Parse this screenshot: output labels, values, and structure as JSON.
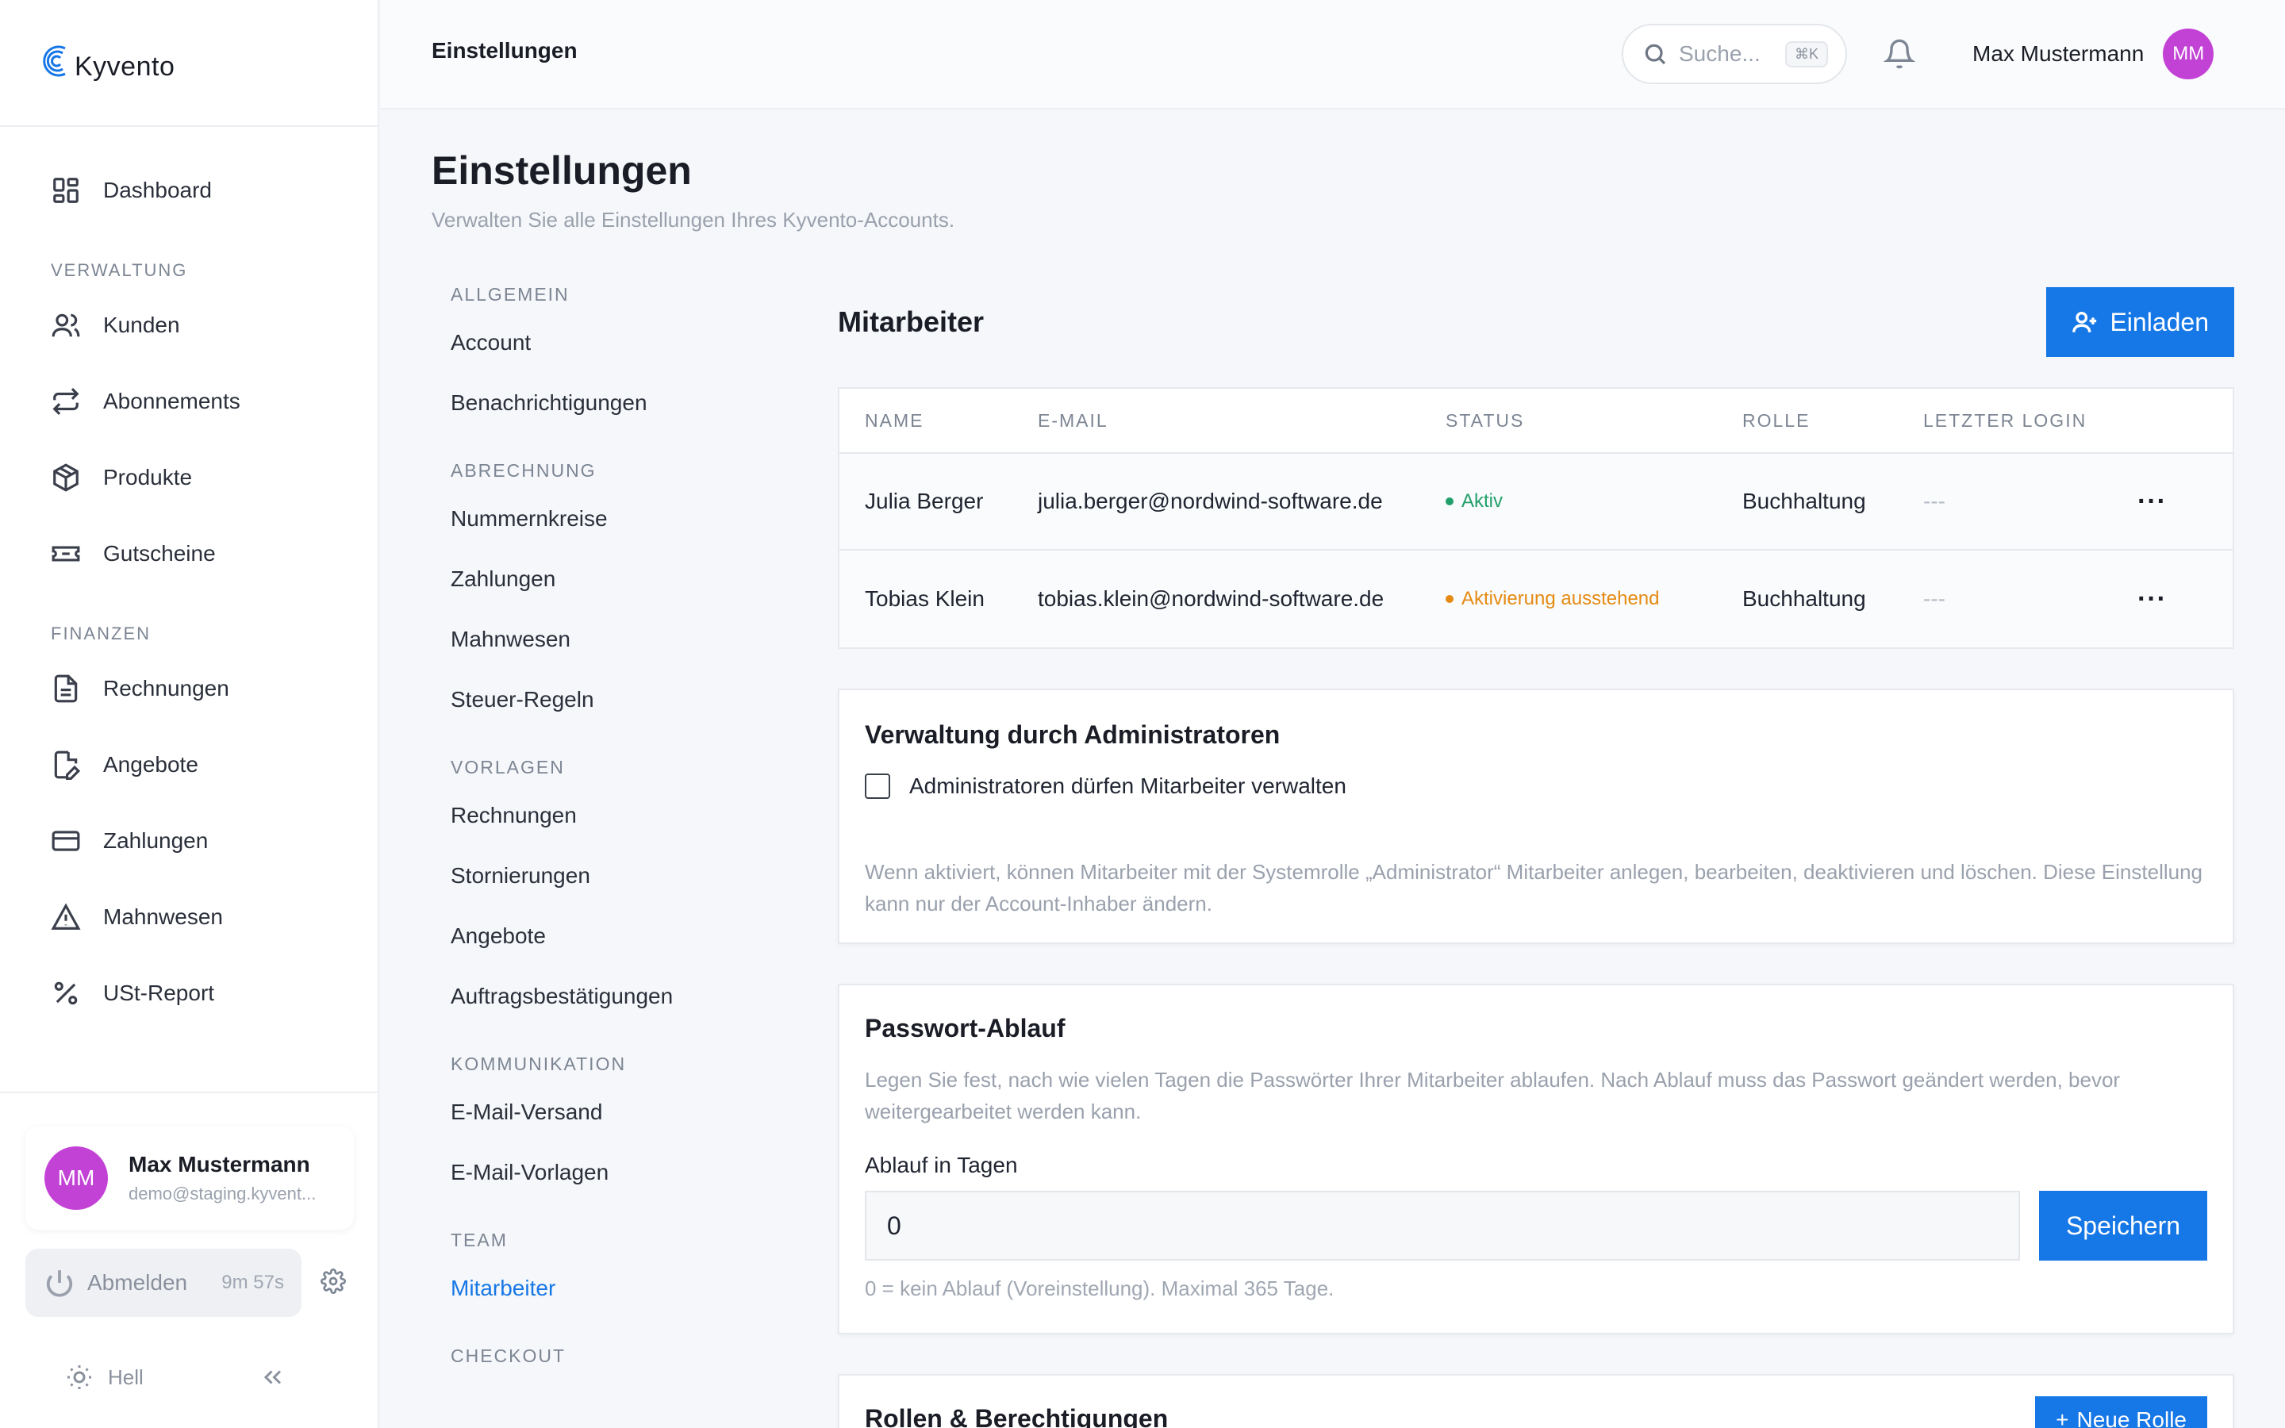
{
  "app": {
    "name": "Kyvento"
  },
  "sidebar": {
    "dashboard": "Dashboard",
    "groups": [
      {
        "label": "VERWALTUNG",
        "items": [
          {
            "label": "Kunden",
            "icon": "users-icon"
          },
          {
            "label": "Abonnements",
            "icon": "repeat-icon"
          },
          {
            "label": "Produkte",
            "icon": "box-icon"
          },
          {
            "label": "Gutscheine",
            "icon": "ticket-icon"
          }
        ]
      },
      {
        "label": "FINANZEN",
        "items": [
          {
            "label": "Rechnungen",
            "icon": "file-text-icon"
          },
          {
            "label": "Angebote",
            "icon": "file-edit-icon"
          },
          {
            "label": "Zahlungen",
            "icon": "credit-card-icon"
          },
          {
            "label": "Mahnwesen",
            "icon": "alert-triangle-icon"
          },
          {
            "label": "USt-Report",
            "icon": "percent-icon"
          }
        ]
      }
    ],
    "user": {
      "initials": "MM",
      "name": "Max Mustermann",
      "email": "demo@staging.kyvent..."
    },
    "logout": "Abmelden",
    "timer": "9m 57s",
    "theme": "Hell"
  },
  "topbar": {
    "title": "Einstellungen",
    "search_placeholder": "Suche...",
    "shortcut": "⌘K",
    "user_name": "Max Mustermann",
    "user_initials": "MM"
  },
  "page": {
    "title": "Einstellungen",
    "subtitle": "Verwalten Sie alle Einstellungen Ihres Kyvento-Accounts."
  },
  "settings_nav": [
    {
      "label": "ALLGEMEIN",
      "items": [
        "Account",
        "Benachrichtigungen"
      ]
    },
    {
      "label": "ABRECHNUNG",
      "items": [
        "Nummernkreise",
        "Zahlungen",
        "Mahnwesen",
        "Steuer-Regeln"
      ]
    },
    {
      "label": "VORLAGEN",
      "items": [
        "Rechnungen",
        "Stornierungen",
        "Angebote",
        "Auftragsbestätigungen"
      ]
    },
    {
      "label": "KOMMUNIKATION",
      "items": [
        "E-Mail-Versand",
        "E-Mail-Vorlagen"
      ]
    },
    {
      "label": "TEAM",
      "items": [
        "Mitarbeiter"
      ]
    },
    {
      "label": "CHECKOUT",
      "items": []
    }
  ],
  "employees": {
    "title": "Mitarbeiter",
    "invite": "Einladen",
    "columns": [
      "NAME",
      "E-MAIL",
      "STATUS",
      "ROLLE",
      "LETZTER LOGIN"
    ],
    "rows": [
      {
        "name": "Julia Berger",
        "email": "julia.berger@nordwind-software.de",
        "status": "Aktiv",
        "status_color": "#22a06b",
        "role": "Buchhaltung",
        "last_login": "---"
      },
      {
        "name": "Tobias Klein",
        "email": "tobias.klein@nordwind-software.de",
        "status": "Aktivierung ausstehend",
        "status_color": "#e58a12",
        "role": "Buchhaltung",
        "last_login": "---"
      }
    ]
  },
  "admin_card": {
    "title": "Verwaltung durch Administratoren",
    "checkbox_label": "Administratoren dürfen Mitarbeiter verwalten",
    "help": "Wenn aktiviert, können Mitarbeiter mit der Systemrolle „Administrator“ Mitarbeiter anlegen, bearbeiten, deaktivieren und löschen. Diese Einstellung kann nur der Account-Inhaber ändern."
  },
  "password_card": {
    "title": "Passwort-Ablauf",
    "help": "Legen Sie fest, nach wie vielen Tagen die Passwörter Ihrer Mitarbeiter ablaufen. Nach Ablauf muss das Passwort geändert werden, bevor weitergearbeitet werden kann.",
    "field_label": "Ablauf in Tagen",
    "value": "0",
    "save": "Speichern",
    "hint": "0 = kein Ablauf (Voreinstellung). Maximal 365 Tage."
  },
  "roles_card": {
    "title": "Rollen & Berechtigungen",
    "new_role": "Neue Rolle"
  },
  "colors": {
    "accent": "#1677e6",
    "avatar": "#c342d6"
  }
}
